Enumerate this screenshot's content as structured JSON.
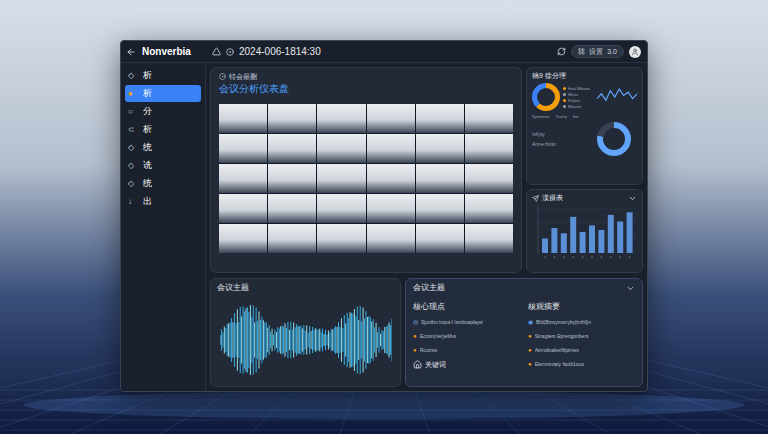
{
  "window": {
    "title": "Nonverbia",
    "timestamp": "2024-006-1814:30"
  },
  "toolbar": {
    "pill_label": "设置",
    "version": "3.0"
  },
  "sidebar": {
    "items": [
      {
        "icon": "◇",
        "label": "析",
        "selected": false
      },
      {
        "icon": "●",
        "label": "析",
        "selected": true
      },
      {
        "icon": "○",
        "label": "分",
        "selected": false
      },
      {
        "icon": "⊂",
        "label": "析",
        "selected": false
      },
      {
        "icon": "◇",
        "label": "统",
        "selected": false
      },
      {
        "icon": "◇",
        "label": "诜",
        "selected": false
      },
      {
        "icon": "◇",
        "label": "统",
        "selected": false
      },
      {
        "icon": "↓",
        "label": "出",
        "selected": false
      }
    ]
  },
  "overview": {
    "subtitle": "特会最蒯",
    "title": "会议分析仪表盘"
  },
  "emotion_panel": {
    "title": "稿9 徐分理",
    "donut": {
      "values": [
        62,
        38
      ],
      "colors": [
        "#f59e0b",
        "#3b82f6"
      ]
    },
    "legend": [
      {
        "label": "Heal Mbuwn",
        "color": "#f59e0b"
      },
      {
        "label": "Mhau",
        "color": "#9ca3af"
      },
      {
        "label": "Ruktor",
        "color": "#f59e0b"
      },
      {
        "label": "Mitutnn",
        "color": "#9ca3af"
      }
    ],
    "sparkline": [
      4,
      7,
      3,
      9,
      5,
      10,
      6,
      8,
      4,
      7
    ],
    "stats": [
      "Systemos",
      "Yuetry",
      "Itnt"
    ],
    "notes": [
      "Isfiyty",
      "Anne hinio"
    ],
    "donut2": {
      "level": 0.78,
      "color": "#60a5fa"
    }
  },
  "bar_panel": {
    "title": "漢摄表",
    "values": [
      22,
      38,
      30,
      55,
      32,
      42,
      35,
      58,
      48,
      62
    ],
    "max": 70
  },
  "waveform_panel": {
    "title": "会议主题"
  },
  "topics_panel": {
    "title": "会议主题",
    "left": {
      "heading": "核心现点",
      "items": [
        {
          "icon": "◎",
          "text": "Sjunibn tnput-l lsmbvaplayel",
          "color": "#93c5fd"
        },
        {
          "icon": "●",
          "text": "Ecnon(ner)eMvs",
          "color": "#f59e0b"
        },
        {
          "icon": "●",
          "text": "Rcutnre.",
          "color": "#f59e0b"
        }
      ],
      "keyword": "关键词"
    },
    "right": {
      "heading": "核观摘要",
      "items": [
        {
          "icon": "◉",
          "text": "Bfd(Bmsymonyby[mihl]in",
          "color": "#60a5fa"
        },
        {
          "icon": "●",
          "text": "Sinagtem Eprengonbers",
          "color": "#f59e0b"
        },
        {
          "icon": "●",
          "text": "Atnndinabe/ftlpirnes",
          "color": "#f59e0b"
        },
        {
          "icon": "●",
          "text": "Elenmmtaty faulit1ouo",
          "color": "#f59e0b"
        }
      ]
    }
  }
}
